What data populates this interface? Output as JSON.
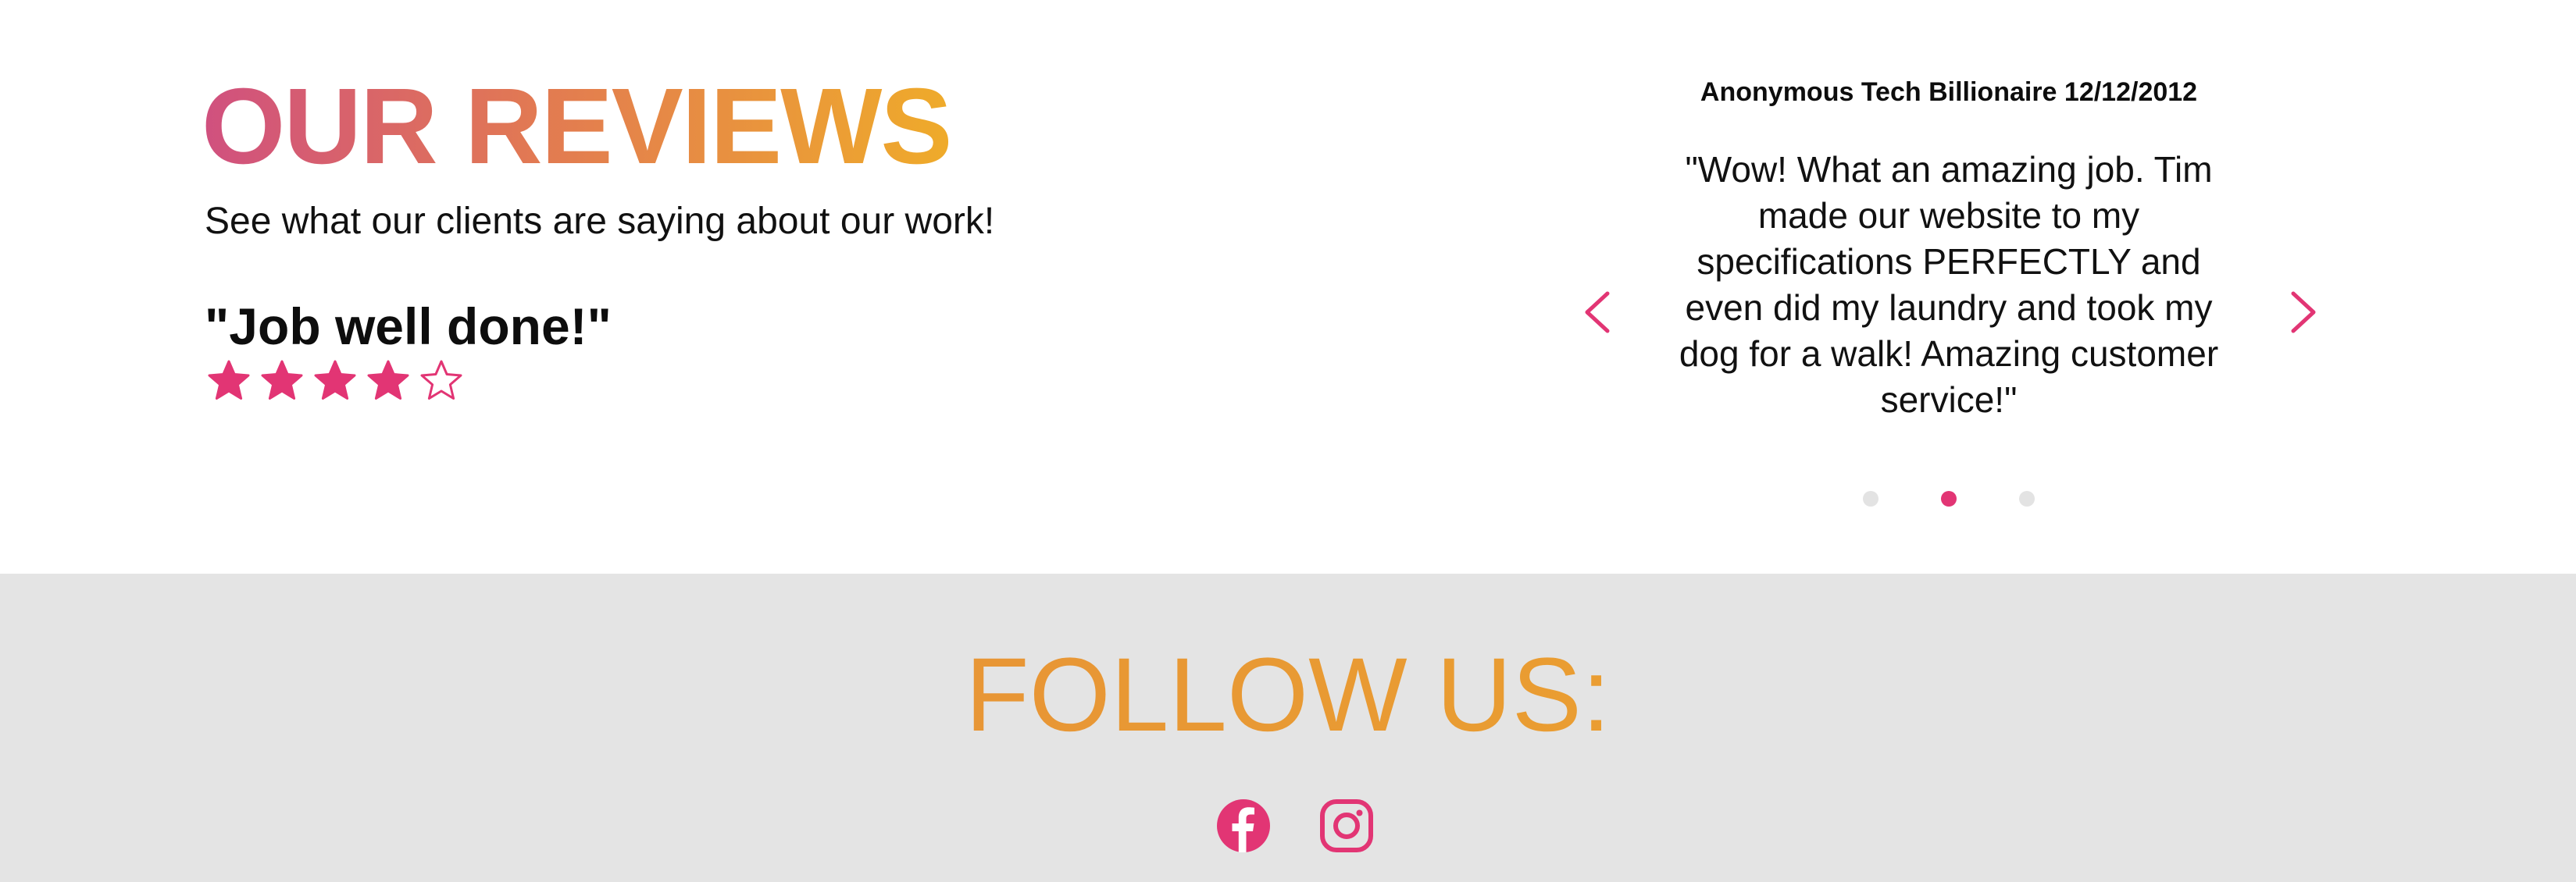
{
  "reviews": {
    "title": "OUR REVIEWS",
    "subtitle": "See what our clients are saying about our work!",
    "featured_quote": "\"Job well done!\"",
    "rating": 4,
    "rating_max": 5
  },
  "carousel": {
    "author": "Anonymous Tech Billionaire 12/12/2012",
    "text": "\"Wow! What an amazing job. Tim made our website to my specifications PERFECTLY and even did my laundry and took my dog for a walk! Amazing customer service!\"",
    "slide_count": 3,
    "active_slide": 2
  },
  "follow": {
    "title": "FOLLOW US:",
    "links": [
      {
        "icon": "facebook-icon"
      },
      {
        "icon": "instagram-icon"
      }
    ]
  },
  "colors": {
    "accent_pink": "#e23574",
    "title_gradient_start": "#d0507f",
    "title_gradient_end": "#efab2a",
    "follow_gradient_start": "#e48a3b",
    "follow_gradient_end": "#eda92c",
    "dot_inactive": "#e3e3e3",
    "footer_bg": "#e4e4e4"
  }
}
